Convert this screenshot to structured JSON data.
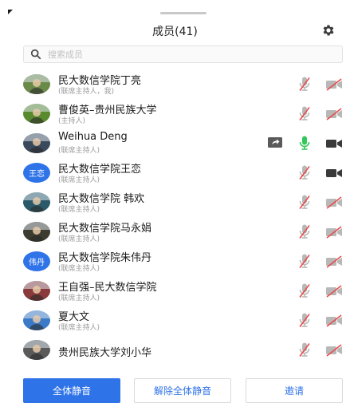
{
  "header": {
    "title": "成员(41)",
    "settings_icon": "gear-icon"
  },
  "search": {
    "placeholder": "搜索成员",
    "icon": "search-icon"
  },
  "colors": {
    "accent": "#2f73e8",
    "mic_active": "#34c759",
    "muted_icon": "#b8b8b8",
    "muted_slash": "#e84c4c"
  },
  "members": [
    {
      "name": "民大数信学院丁亮",
      "role": "(联席主持人，我)",
      "avatar": "photo",
      "avatar_color": "#6a8a4a",
      "sharing": false,
      "mic_on": false,
      "cam_on": false
    },
    {
      "name": "曹俊英–贵州民族大学",
      "role": "(主持人)",
      "avatar": "photo",
      "avatar_color": "#5a8a2e",
      "sharing": false,
      "mic_on": false,
      "cam_on": false
    },
    {
      "name": "Weihua Deng",
      "role": "(联席主持人)",
      "avatar": "photo",
      "avatar_color": "#3a4a5c",
      "sharing": true,
      "mic_on": true,
      "cam_on": true
    },
    {
      "name": "民大数信学院王恋",
      "role": "(联席主持人)",
      "avatar": "text",
      "avatar_text": "王恋",
      "sharing": false,
      "mic_on": false,
      "cam_on": true
    },
    {
      "name": "民大数信学院 韩欢",
      "role": "(联席主持人)",
      "avatar": "photo",
      "avatar_color": "#2a5a6a",
      "sharing": false,
      "mic_on": false,
      "cam_on": false
    },
    {
      "name": "民大数信学院马永娟",
      "role": "(联席主持人)",
      "avatar": "photo",
      "avatar_color": "#3c3c30",
      "sharing": false,
      "mic_on": false,
      "cam_on": false
    },
    {
      "name": "民大数信学院朱伟丹",
      "role": "(联席主持人)",
      "avatar": "text",
      "avatar_text": "伟丹",
      "sharing": false,
      "mic_on": false,
      "cam_on": false
    },
    {
      "name": "王自强–民大数信学院",
      "role": "(联席主持人)",
      "avatar": "photo",
      "avatar_color": "#8a3a3a",
      "sharing": false,
      "mic_on": false,
      "cam_on": false
    },
    {
      "name": "夏大文",
      "role": "(联席主持人)",
      "avatar": "photo",
      "avatar_color": "#3a7ac8",
      "sharing": false,
      "mic_on": false,
      "cam_on": false
    },
    {
      "name": "贵州民族大学刘小华",
      "role": "",
      "avatar": "photo",
      "avatar_color": "#5a5a5a",
      "sharing": false,
      "mic_on": false,
      "cam_on": false
    }
  ],
  "buttons": {
    "mute_all": "全体静音",
    "unmute_all": "解除全体静音",
    "invite": "邀请"
  }
}
